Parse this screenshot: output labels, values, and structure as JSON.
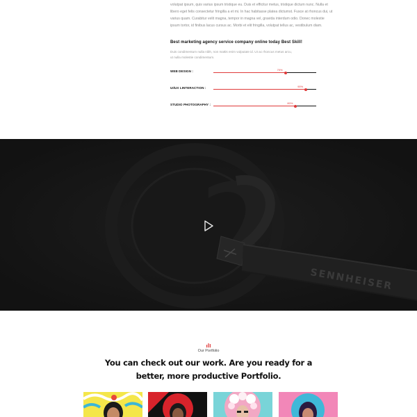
{
  "intro": {
    "lines": [
      "volutpat ipsum, quis varius ipsum tristique eu. Duis et efficitur metus, tristique dictum nunc. Nulla et",
      "libero eget felis consectetur fringilla a et mi. In hac habitasse platea dictumst. Fusce at rhoncus dui, ut",
      "varius quam. Curabitur velit magna, tempor in magna vel, gravida interdum odio. Donec molestie",
      "ipsum tortor, id finibus lacus cursus ac. Morbi et elit fringilla, volutpat tellus ac, vestibulum diam."
    ]
  },
  "skills": {
    "title": "Best marketing agency service company online today Best Skill!",
    "desc_lines": [
      "Duis condimentum nulla nibh, non mattis enim vulputate id. Ut ac rhoncus metus arcu,",
      "ut nulla molestie condimentum."
    ],
    "items": [
      {
        "label": "WEB DESIGN :",
        "percent_label": "70%",
        "level": 0.7
      },
      {
        "label": "UI/UX LINTERACTION :",
        "percent_label": "90%",
        "level": 0.9
      },
      {
        "label": "STUDIO PHOTOGRAPHY :",
        "percent_label": "80%",
        "level": 0.8
      }
    ],
    "accent_color": "#e03a3a"
  },
  "video": {
    "brand": "SENNHEISER",
    "play_icon": "play-icon",
    "background_color": "#161616"
  },
  "portfolio": {
    "icon": "portfolio-icon",
    "subtitle": "Our Portfolio",
    "heading_line1": "You can check out our work. Are you ready for a",
    "heading_line2": "better, more productive Portfolio.",
    "accent_color": "#e03a3a",
    "items": [
      {
        "name": "portfolio-item-1",
        "bg": "#f4e64a"
      },
      {
        "name": "portfolio-item-2",
        "bg": "#d8232b"
      },
      {
        "name": "portfolio-item-3",
        "bg": "#79d4d8"
      },
      {
        "name": "portfolio-item-4",
        "bg": "#f287b8"
      }
    ]
  }
}
